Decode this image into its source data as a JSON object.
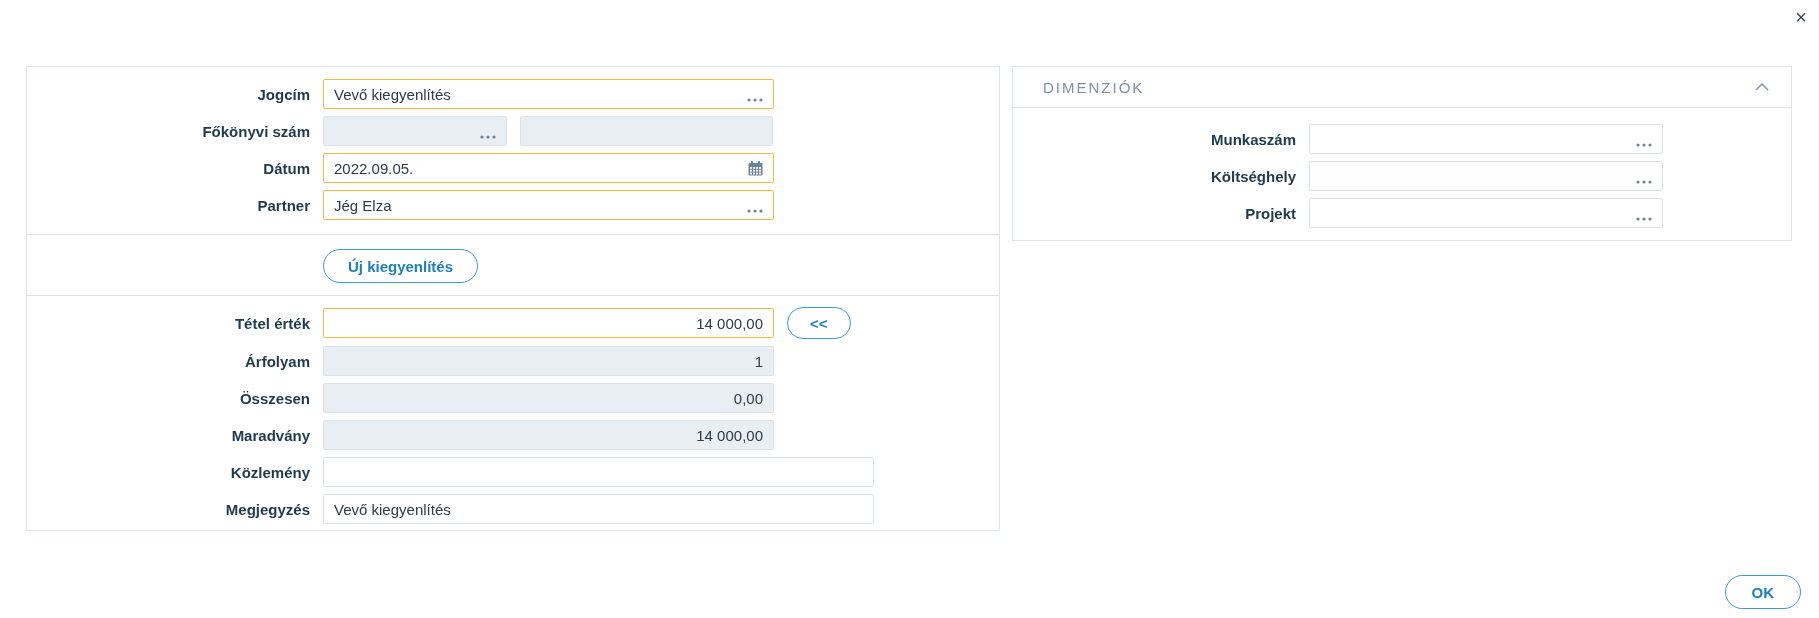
{
  "close_label": "×",
  "main_form": {
    "header_fields": [
      {
        "label": "Jogcím",
        "kind": "lookup",
        "value": "Vevő kiegyenlítés",
        "required": true,
        "disabled": false
      },
      {
        "label": "Főkönyvi szám",
        "kind": "split_lookup",
        "required": false,
        "disabled": true
      },
      {
        "label": "Dátum",
        "kind": "date",
        "value": "2022.09.05.",
        "required": true,
        "disabled": false
      },
      {
        "label": "Partner",
        "kind": "lookup",
        "value": "Jég Elza",
        "required": true,
        "disabled": false
      }
    ],
    "new_button": "Új kiegyenlítés",
    "amount_fields": [
      {
        "label": "Tétel érték",
        "kind": "number",
        "value": "14 000,00",
        "required": true,
        "disabled": false,
        "action": "<<"
      },
      {
        "label": "Árfolyam",
        "kind": "number",
        "value": "1",
        "required": false,
        "disabled": true
      },
      {
        "label": "Összesen",
        "kind": "number",
        "value": "0,00",
        "required": false,
        "disabled": true
      },
      {
        "label": "Maradvány",
        "kind": "number",
        "value": "14 000,00",
        "required": false,
        "disabled": true
      },
      {
        "label": "Közlemény",
        "kind": "wide_text",
        "required": false,
        "disabled": false
      },
      {
        "label": "Megjegyzés",
        "kind": "wide_text",
        "value": "Vevő kiegyenlítés",
        "required": false,
        "disabled": false
      }
    ]
  },
  "dimensions": {
    "title": "DIMENZIÓK",
    "expanded": true,
    "fields": [
      {
        "label": "Munkaszám",
        "kind": "lookup",
        "required": false,
        "disabled": false
      },
      {
        "label": "Költséghely",
        "kind": "lookup",
        "required": false,
        "disabled": false
      },
      {
        "label": "Projekt",
        "kind": "lookup",
        "required": false,
        "disabled": false
      }
    ]
  },
  "ok_button": "OK"
}
